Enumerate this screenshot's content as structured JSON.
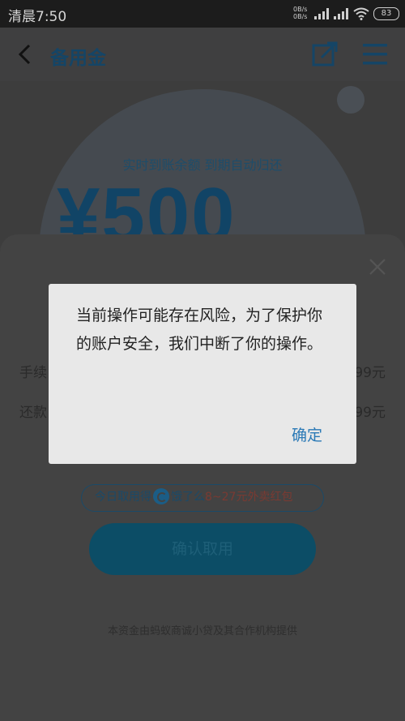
{
  "status_bar": {
    "time": "清晨7:50",
    "net_up": "0B/s",
    "net_down": "0B/s",
    "battery": "83"
  },
  "header": {
    "title": "备用金",
    "back_icon": "chevron-left-icon",
    "share_icon": "edit-share-icon",
    "menu_icon": "hamburger-menu-icon"
  },
  "hero": {
    "subtitle": "实时到账余额 到期自动归还",
    "amount": "¥500"
  },
  "sheet": {
    "fee_label": "手续",
    "fee_value": "99元",
    "repay_label": "还款",
    "repay_value": "99元",
    "promo_prefix": "今日取用得",
    "promo_brand": "饿了么",
    "promo_highlight": "8~27元外卖红包",
    "confirm_label": "确认取用",
    "footer_note": "本资金由蚂蚁商诚小贷及其合作机构提供"
  },
  "dialog": {
    "message": "当前操作可能存在风险，为了保护你的账户安全，我们中断了你的操作。",
    "confirm_label": "确定"
  },
  "colors": {
    "dialog_bg": "#e8e8e8",
    "accent": "#2a79b6",
    "dim_overlay": "#3d3d3d"
  }
}
